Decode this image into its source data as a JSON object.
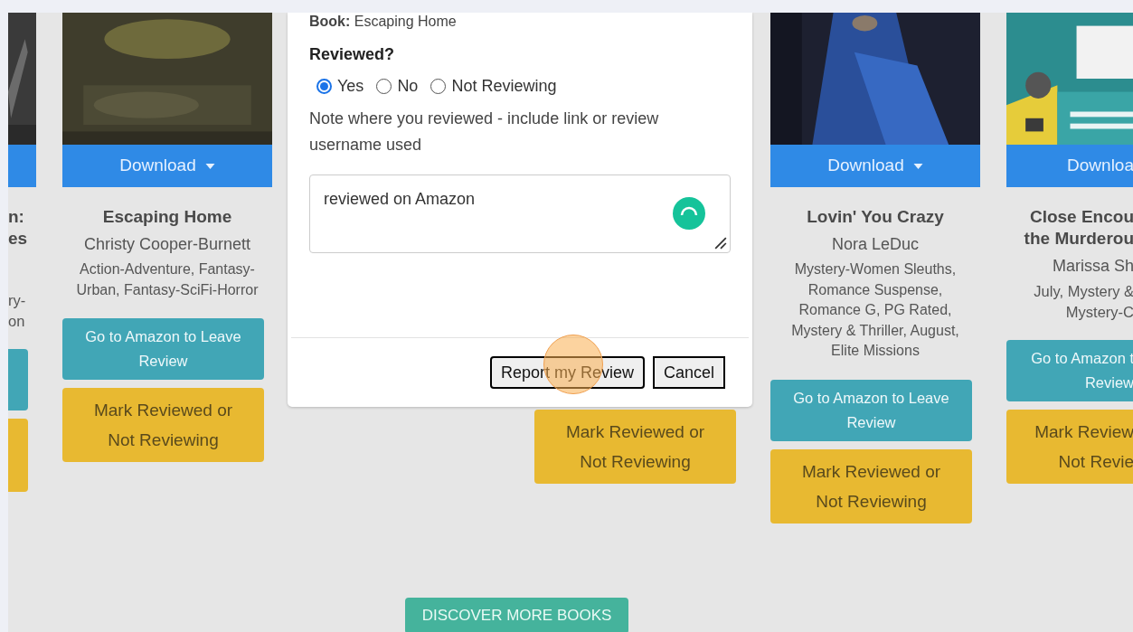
{
  "cards": [
    {
      "kind": "clipped_left",
      "cover": {
        "kind": "picture"
      },
      "title_lines": [
        "n:",
        "es"
      ],
      "genre_lines": [
        "ry-",
        "on"
      ]
    },
    {
      "kind": "full",
      "cover": {
        "kind": "picture"
      },
      "download": "Download",
      "title": "Escaping Home",
      "author": "Christy Cooper-Burnett",
      "genres": "Action-Adventure, Fantasy-Urban, Fantasy-SciFi-Horror",
      "amazon_button": "Go to Amazon to Leave Review",
      "mark_button": "Mark Reviewed or Not Reviewing"
    },
    {
      "kind": "covered"
    },
    {
      "kind": "covered",
      "mark_button": "Mark Reviewed or Not Reviewing"
    },
    {
      "kind": "full",
      "cover": {
        "kind": "picture"
      },
      "download": "Download",
      "title": "Lovin' You Crazy",
      "author": "Nora LeDuc",
      "genres": "Mystery-Women Sleuths, Romance Suspense, Romance G, PG Rated, Mystery & Thriller, August, Elite Missions",
      "amazon_button": "Go to Amazon to Leave Review",
      "mark_button": "Mark Reviewed or Not Reviewing"
    },
    {
      "kind": "clipped_right",
      "cover": {
        "kind": "picture"
      },
      "download": "Downloa",
      "title_lines": [
        "Close Encou",
        "the Murderou"
      ],
      "author": "Marissa Sh",
      "genre_lines": [
        "July, Mystery &",
        "Mystery-C"
      ],
      "amazon_lines": [
        "Go to Amazon t",
        "Review"
      ],
      "mark_lines": [
        "Mark Review",
        "Not Revie"
      ]
    }
  ],
  "modal": {
    "header": "**Book:** Escaping Home",
    "question": "Reviewed?",
    "options": [
      {
        "label": "Yes",
        "selected": true
      },
      {
        "label": "No",
        "selected": false
      },
      {
        "label": "Not Reviewing",
        "selected": false
      }
    ],
    "note_label": "Note where you reviewed - include link or review username used",
    "review_text": "reviewed on Amazon",
    "buttons": [
      {
        "label": "Report my Review",
        "kind": "submit"
      },
      {
        "label": "Cancel",
        "kind": "cancel"
      }
    ]
  },
  "discover_button": "DISCOVER MORE BOOKS"
}
